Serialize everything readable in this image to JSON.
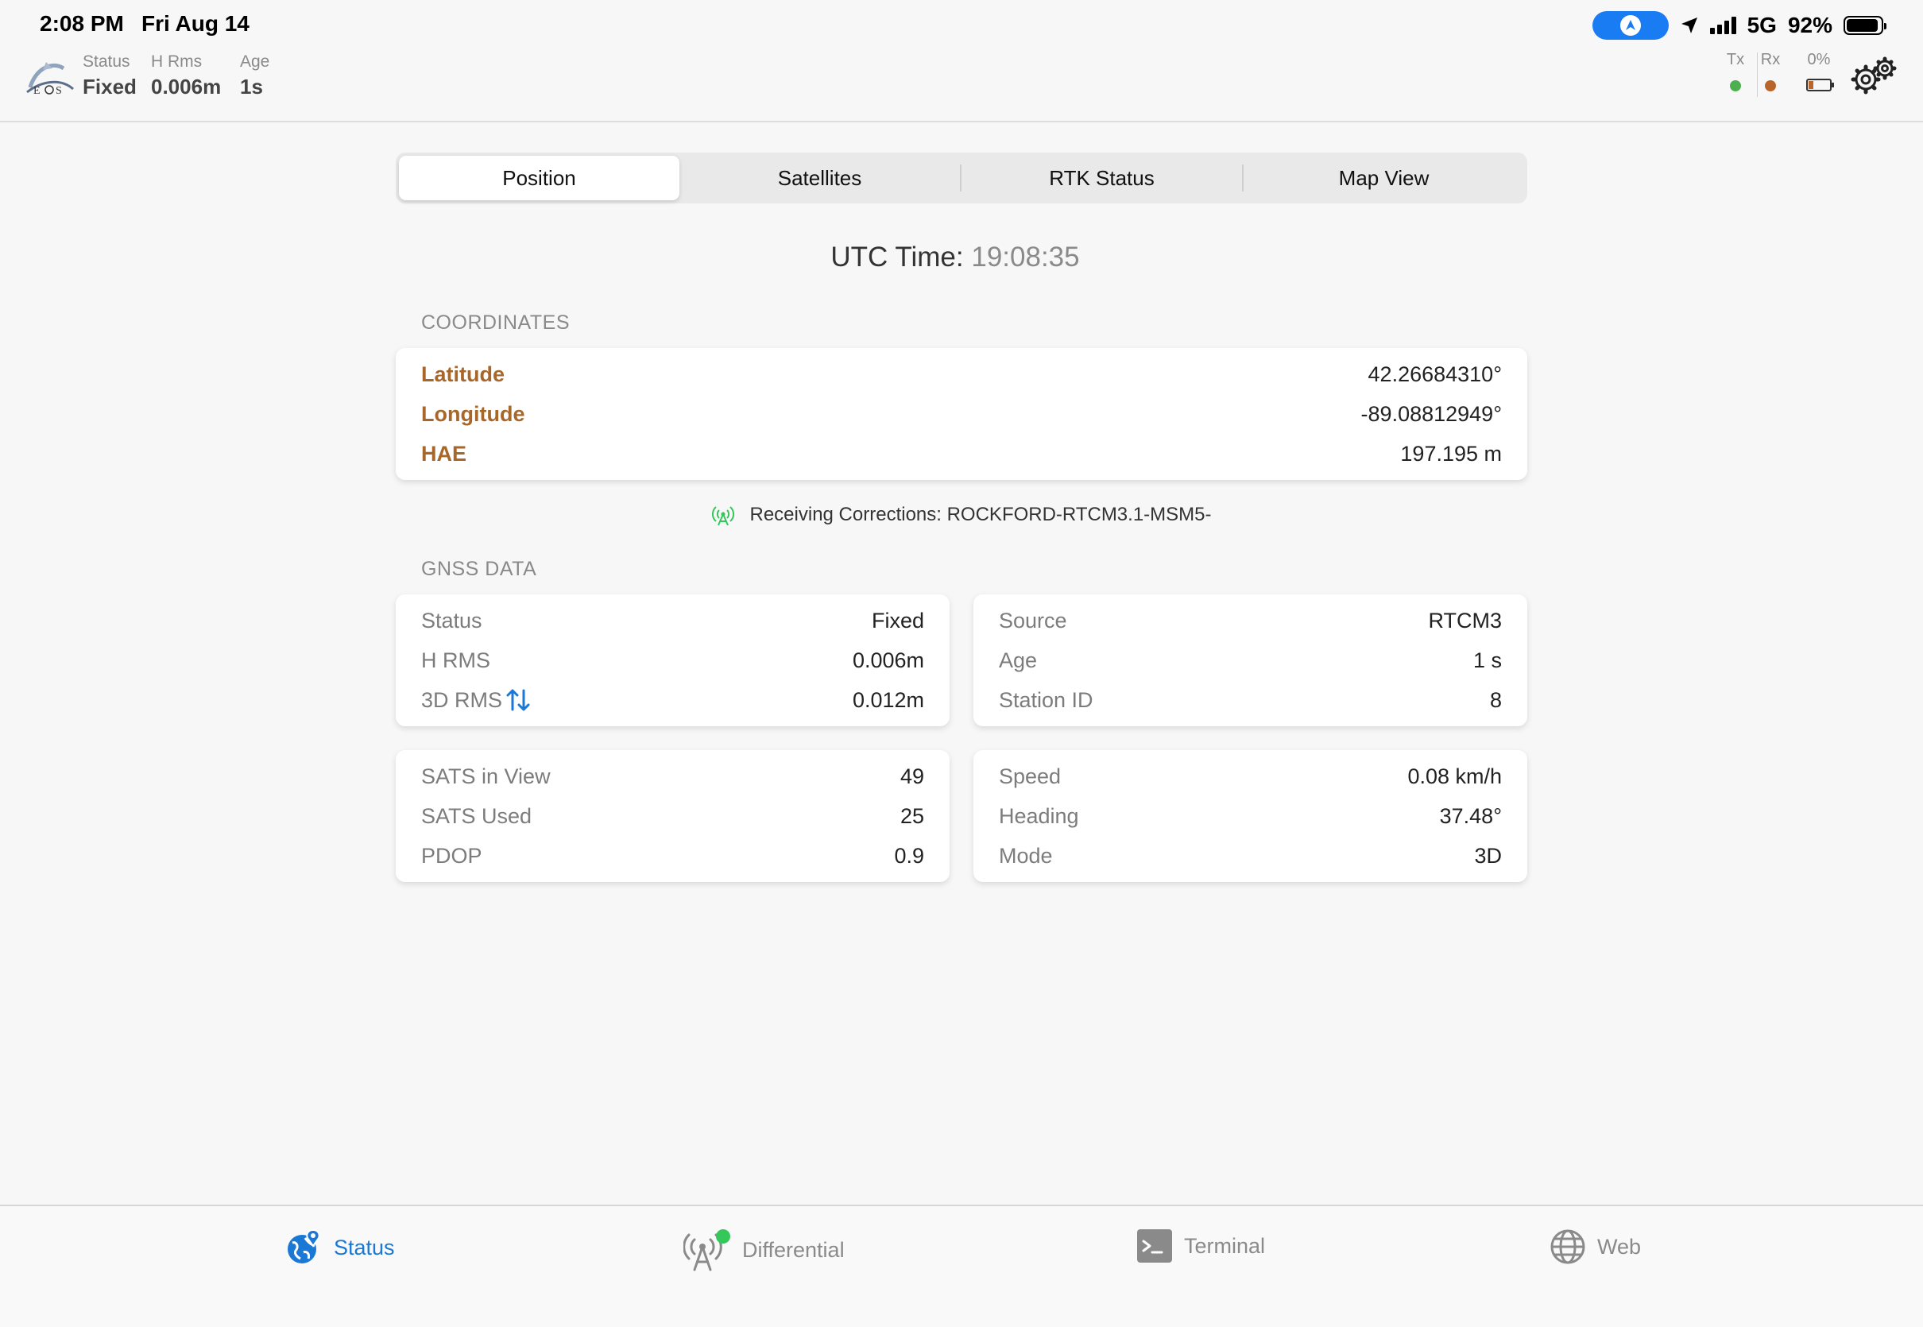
{
  "status_bar": {
    "time": "2:08 PM",
    "date": "Fri Aug 14",
    "network": "5G",
    "battery_pct": "92%"
  },
  "header": {
    "logo_name": "eos-logo",
    "status_label": "Status",
    "status_value": "Fixed",
    "hrms_label": "H Rms",
    "hrms_value": "0.006m",
    "age_label": "Age",
    "age_value": "1s",
    "tx_label": "Tx",
    "rx_label": "Rx",
    "device_battery": "0%",
    "colors": {
      "tx": "#4caf50",
      "rx": "#b9652a"
    }
  },
  "tabs": [
    {
      "label": "Position",
      "active": true
    },
    {
      "label": "Satellites",
      "active": false
    },
    {
      "label": "RTK Status",
      "active": false
    },
    {
      "label": "Map View",
      "active": false
    }
  ],
  "utc": {
    "label": "UTC Time:",
    "value": "19:08:35"
  },
  "coordinates": {
    "section_label": "COORDINATES",
    "rows": [
      {
        "label": "Latitude",
        "value": "42.26684310°"
      },
      {
        "label": "Longitude",
        "value": "-89.08812949°"
      },
      {
        "label": "HAE",
        "value": "197.195 m"
      }
    ]
  },
  "corrections": {
    "text": "Receiving Corrections: ROCKFORD-RTCM3.1-MSM5-",
    "icon": "antenna-icon"
  },
  "gnss": {
    "section_label": "GNSS DATA",
    "card_status": [
      {
        "label": "Status",
        "value": "Fixed"
      },
      {
        "label": "H RMS",
        "value": "0.006m"
      },
      {
        "label": "3D RMS",
        "value": "0.012m"
      }
    ],
    "card_source": [
      {
        "label": "Source",
        "value": "RTCM3"
      },
      {
        "label": "Age",
        "value": "1 s"
      },
      {
        "label": "Station ID",
        "value": "8"
      }
    ],
    "card_sats": [
      {
        "label": "SATS in View",
        "value": "49"
      },
      {
        "label": "SATS Used",
        "value": "25"
      },
      {
        "label": "PDOP",
        "value": "0.9"
      }
    ],
    "card_motion": [
      {
        "label": "Speed",
        "value": "0.08 km/h"
      },
      {
        "label": "Heading",
        "value": "37.48°"
      },
      {
        "label": "Mode",
        "value": "3D"
      }
    ]
  },
  "bottom_tabs": [
    {
      "label": "Status",
      "icon": "globe-pin-icon",
      "active": true
    },
    {
      "label": "Differential",
      "icon": "antenna-icon",
      "active": false
    },
    {
      "label": "Terminal",
      "icon": "terminal-icon",
      "active": false
    },
    {
      "label": "Web",
      "icon": "globe-icon",
      "active": false
    }
  ],
  "colors": {
    "accent": "#1b78d4",
    "coordinate_label": "#a8672a",
    "online": "#34c759"
  }
}
